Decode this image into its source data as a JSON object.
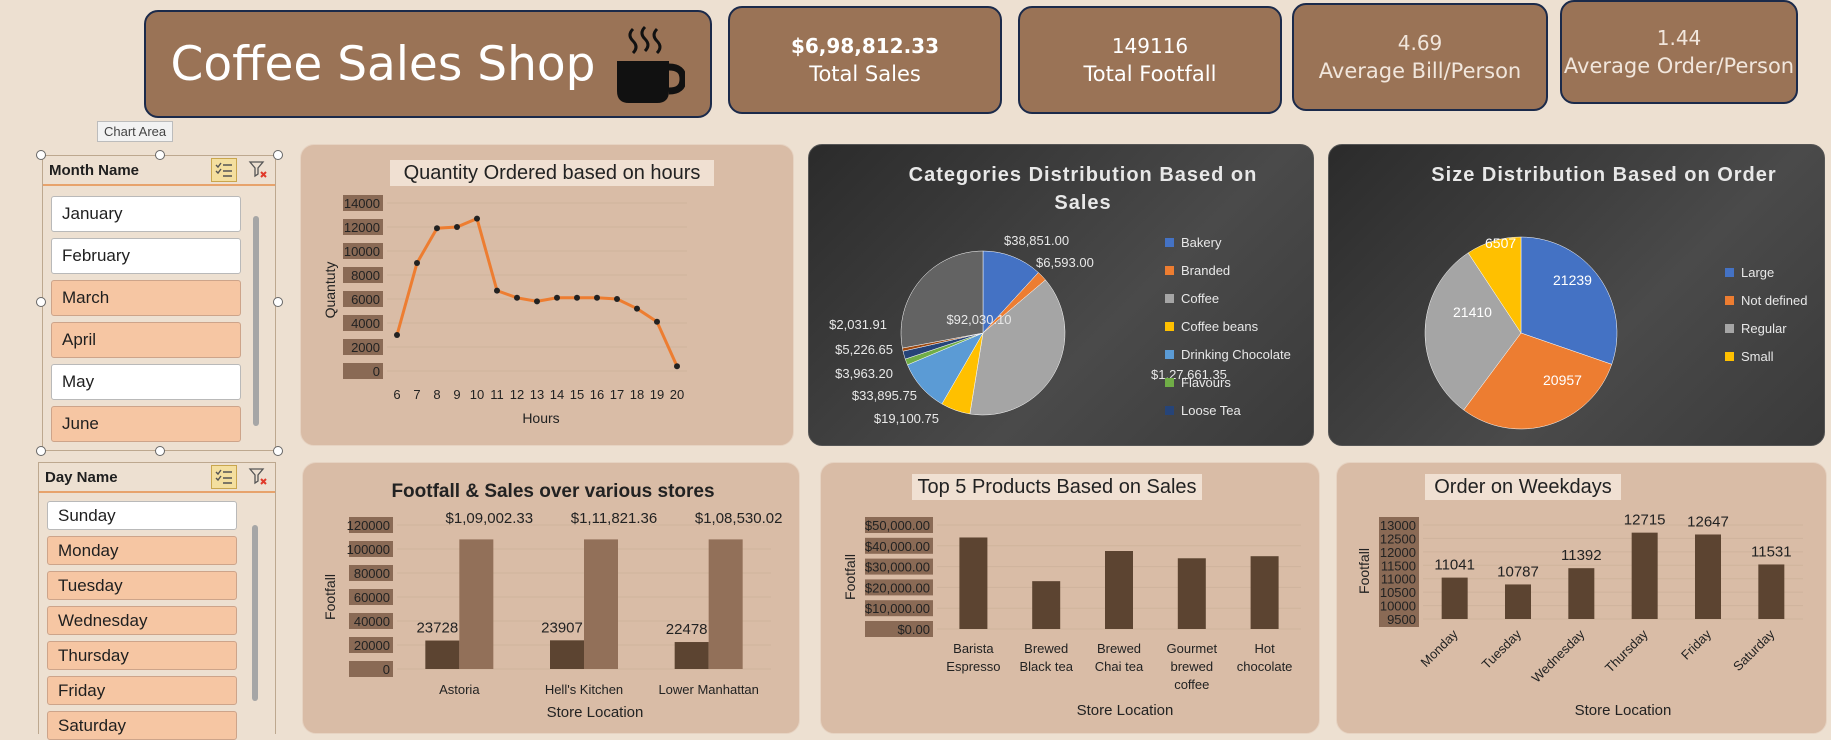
{
  "header": {
    "title": "Coffee Sales Shop",
    "icon": "coffee-cup-icon"
  },
  "kpis": [
    {
      "value": "$6,98,812.33",
      "label": "Total Sales"
    },
    {
      "value": "149116",
      "label": "Total Footfall"
    },
    {
      "value": "4.69",
      "label": "Average Bill/Person"
    },
    {
      "value": "1.44",
      "label": "Average Order/Person"
    }
  ],
  "tooltip": "Chart Area",
  "month_slicer": {
    "title": "Month Name",
    "items": [
      {
        "label": "January",
        "selected": false
      },
      {
        "label": "February",
        "selected": false
      },
      {
        "label": "March",
        "selected": true
      },
      {
        "label": "April",
        "selected": true
      },
      {
        "label": "May",
        "selected": false
      },
      {
        "label": "June",
        "selected": true
      }
    ]
  },
  "day_slicer": {
    "title": "Day Name",
    "items": [
      {
        "label": "Sunday",
        "selected": false
      },
      {
        "label": "Monday",
        "selected": true
      },
      {
        "label": "Tuesday",
        "selected": true
      },
      {
        "label": "Wednesday",
        "selected": true
      },
      {
        "label": "Thursday",
        "selected": true
      },
      {
        "label": "Friday",
        "selected": true
      },
      {
        "label": "Saturday",
        "selected": true
      }
    ]
  },
  "colors": {
    "accent": "#9a7356",
    "panel": "#d9bca6",
    "bar_dark": "#5c4431",
    "bar_light": "#927059",
    "line": "#ed7d31"
  },
  "chart_data": [
    {
      "type": "line",
      "title": "Quantity Ordered based on hours",
      "xlabel": "Hours",
      "ylabel": "Quantuty",
      "x": [
        6,
        7,
        8,
        9,
        10,
        11,
        12,
        13,
        14,
        15,
        16,
        17,
        18,
        19,
        20
      ],
      "values": [
        3000,
        9000,
        11900,
        12000,
        12700,
        6700,
        6100,
        5800,
        6100,
        6100,
        6100,
        6000,
        5200,
        4100,
        400
      ],
      "yticks": [
        "14000",
        "12000",
        "10000",
        "8000",
        "6000",
        "4000",
        "2000",
        "0"
      ],
      "ylim": [
        0,
        14000
      ]
    },
    {
      "type": "pie",
      "title": "Categories Distribution Based on Sales",
      "labels": [
        "Bakery",
        "Branded",
        "Coffee",
        "Coffee beans",
        "Drinking Chocolate",
        "Flavours",
        "Loose Tea"
      ],
      "slices": [
        {
          "name": "Bakery",
          "value": 38851.0,
          "label": "$38,851.00",
          "color": "#4472c4"
        },
        {
          "name": "Branded",
          "value": 6593.0,
          "label": "$6,593.00",
          "color": "#ed7d31"
        },
        {
          "name": "Coffee",
          "value": 127661.35,
          "label": "$1,27,661.35",
          "color": "#a5a5a5"
        },
        {
          "name": "Coffee beans",
          "value": 19100.75,
          "label": "$19,100.75",
          "color": "#ffc000"
        },
        {
          "name": "Drinking Chocolate",
          "value": 33895.75,
          "label": "$33,895.75",
          "color": "#5b9bd5"
        },
        {
          "name": "Flavours",
          "value": 3963.2,
          "label": "$3,963.20",
          "color": "#70ad47"
        },
        {
          "name": "Loose Tea",
          "value": 5226.65,
          "label": "$5,226.65",
          "color": "#264478"
        },
        {
          "name": "",
          "value": 2031.91,
          "label": "$2,031.91",
          "color": "#9e480e"
        },
        {
          "name": "",
          "value": 92030.1,
          "label": "$92,030.10",
          "color": "#636363"
        }
      ]
    },
    {
      "type": "pie",
      "title": "Size Distribution Based on Order",
      "slices": [
        {
          "name": "Large",
          "value": 21239,
          "label": "21239",
          "color": "#4472c4"
        },
        {
          "name": "Not defined",
          "value": 20957,
          "label": "20957",
          "color": "#ed7d31"
        },
        {
          "name": "Regular",
          "value": 21410,
          "label": "21410",
          "color": "#a5a5a5"
        },
        {
          "name": "Small",
          "value": 6507,
          "label": "6507",
          "color": "#ffc000"
        }
      ]
    },
    {
      "type": "bar",
      "title": "Footfall & Sales over various stores",
      "xlabel": "Store Location",
      "ylabel": "Footfall",
      "categories": [
        "Astoria",
        "Hell's Kitchen",
        "Lower Manhattan"
      ],
      "series": [
        {
          "values": [
            23728,
            23907,
            22478
          ],
          "labels": [
            "23728",
            "23907",
            "22478"
          ]
        },
        {
          "values": [
            109002.33,
            111821.36,
            108530.02
          ],
          "labels": [
            "$1,09,002.33",
            "$1,11,821.36",
            "$1,08,530.02"
          ]
        }
      ],
      "yticks": [
        "120000",
        "100000",
        "80000",
        "60000",
        "40000",
        "20000",
        "0"
      ],
      "ylim": [
        0,
        120000
      ]
    },
    {
      "type": "bar",
      "title": "Top 5 Products Based on Sales",
      "xlabel": "Store Location",
      "ylabel": "Footfall",
      "categories": [
        [
          "Barista",
          "Espresso"
        ],
        [
          "Brewed",
          "Black tea"
        ],
        [
          "Brewed",
          "Chai tea"
        ],
        [
          "Gourmet",
          "brewed",
          "coffee"
        ],
        [
          "Hot",
          "chocolate"
        ]
      ],
      "values": [
        44000,
        23000,
        37500,
        34000,
        35000
      ],
      "yticks": [
        "$50,000.00",
        "$40,000.00",
        "$30,000.00",
        "$20,000.00",
        "$10,000.00",
        "$0.00"
      ],
      "ylim": [
        0,
        50000
      ]
    },
    {
      "type": "bar",
      "title": "Order on Weekdays",
      "xlabel": "Store Location",
      "ylabel": "Footfall",
      "categories": [
        "Monday",
        "Tuesday",
        "Wednesday",
        "Thursday",
        "Friday",
        "Saturday"
      ],
      "values": [
        11041,
        10787,
        11392,
        12715,
        12647,
        11531
      ],
      "labels": [
        "11041",
        "10787",
        "11392",
        "12715",
        "12647",
        "11531"
      ],
      "yticks": [
        "13000",
        "12500",
        "12000",
        "11500",
        "11000",
        "10500",
        "10000",
        "9500"
      ],
      "ylim": [
        9500,
        13000
      ]
    }
  ]
}
